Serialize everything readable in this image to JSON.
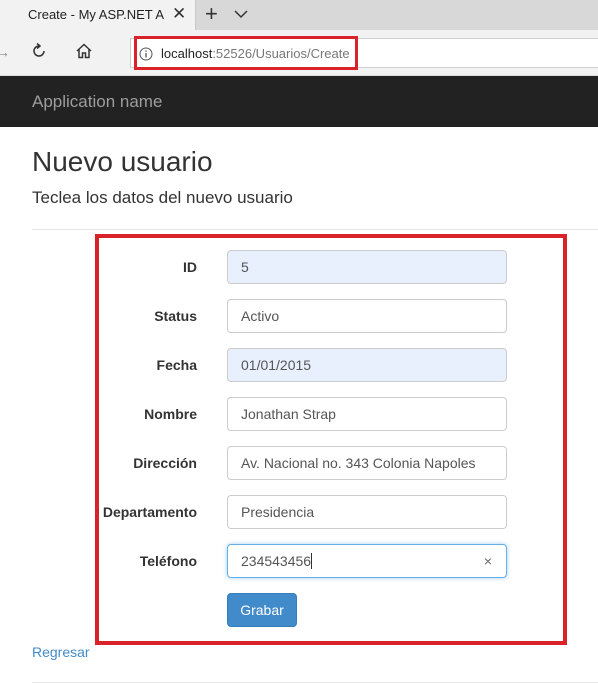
{
  "browser": {
    "tab_title": "Create - My ASP.NET Ap",
    "tab_close_icon": "close-icon",
    "new_tab_icon": "plus-icon",
    "tab_dropdown_icon": "chevron-down-icon",
    "url_host": "localhost",
    "url_rest": ":52526/Usuarios/Create"
  },
  "navbar": {
    "brand": "Application name"
  },
  "page": {
    "title": "Nuevo usuario",
    "subtitle": "Teclea los datos del nuevo usuario"
  },
  "form": {
    "fields": [
      {
        "label": "ID",
        "value": "5"
      },
      {
        "label": "Status",
        "value": "Activo"
      },
      {
        "label": "Fecha",
        "value": "01/01/2015"
      },
      {
        "label": "Nombre",
        "value": "Jonathan Strap"
      },
      {
        "label": "Dirección",
        "value": "Av. Nacional no. 343 Colonia Napoles"
      },
      {
        "label": "Departamento",
        "value": "Presidencia"
      },
      {
        "label": "Teléfono",
        "value": "234543456"
      }
    ],
    "submit_label": "Grabar",
    "clear_glyph": "×"
  },
  "links": {
    "back": "Regresar"
  },
  "colors": {
    "highlight": "#d9232b",
    "navbar_bg": "#222222",
    "primary": "#428bca",
    "autofill_bg": "#e8f0fe"
  }
}
